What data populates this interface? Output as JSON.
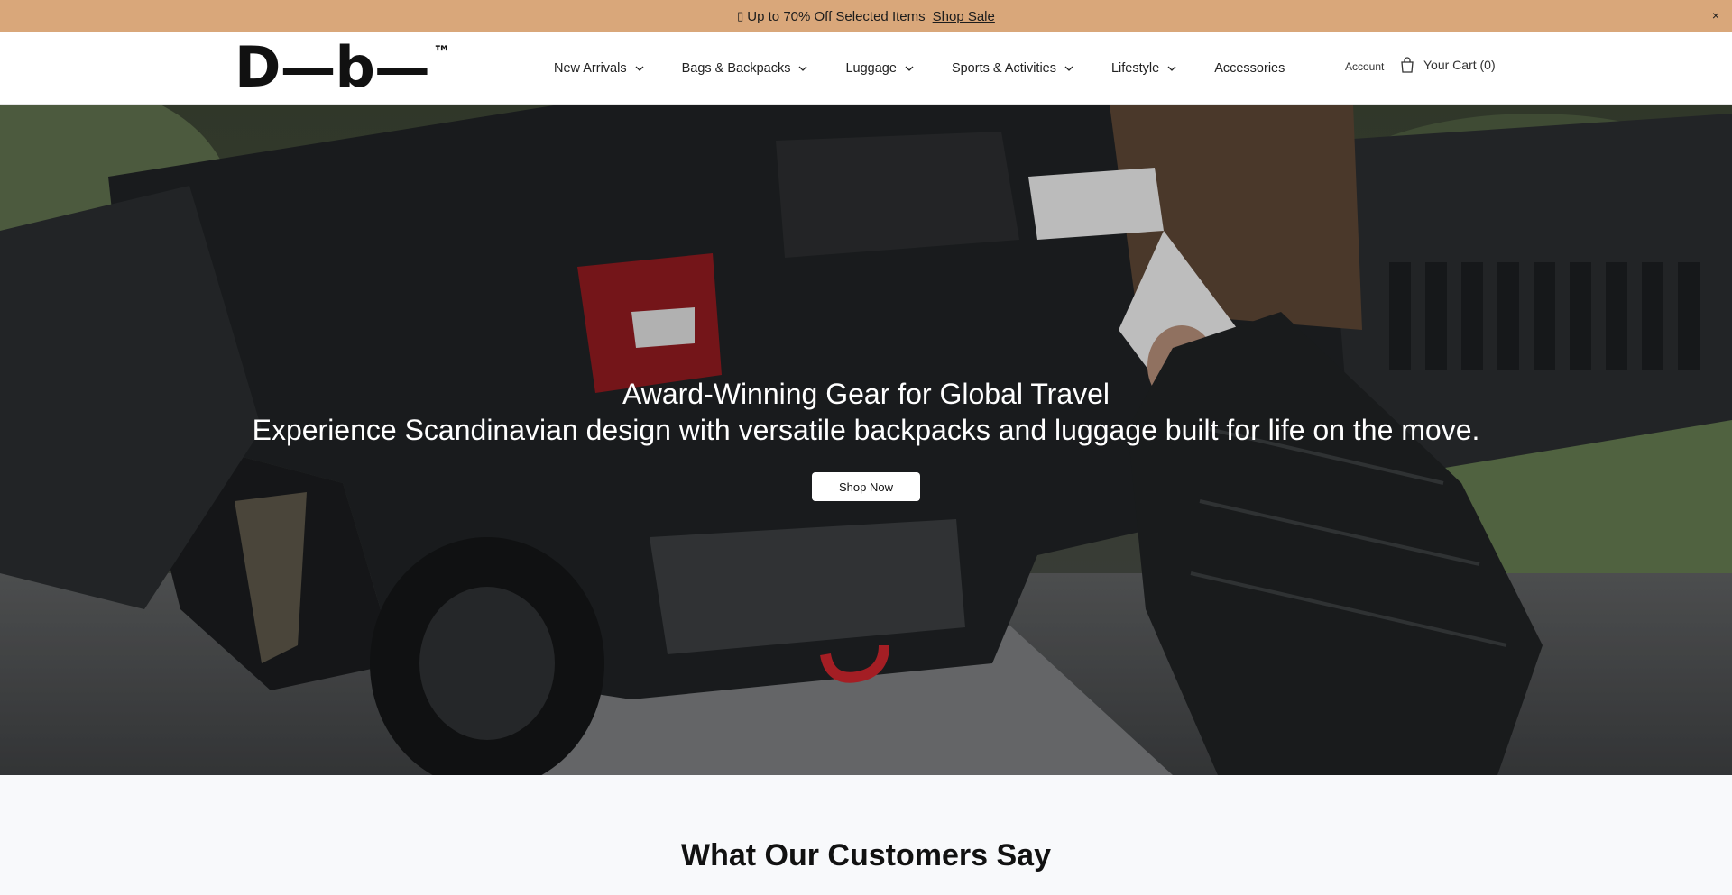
{
  "announcement": {
    "icon": "gift-icon",
    "message": "Up to 70% Off Selected Items",
    "link": "Shop Sale",
    "close": "×",
    "background": "#d9a77a"
  },
  "header": {
    "logo": "D—b—",
    "logo_tm": "™",
    "nav": [
      {
        "label": "New Arrivals",
        "has_dropdown": true
      },
      {
        "label": "Bags & Backpacks",
        "has_dropdown": true
      },
      {
        "label": "Luggage",
        "has_dropdown": true
      },
      {
        "label": "Sports & Activities",
        "has_dropdown": true
      },
      {
        "label": "Lifestyle",
        "has_dropdown": true
      },
      {
        "label": "Accessories",
        "has_dropdown": false
      }
    ],
    "account": "Account",
    "cart": "Your Cart (0)"
  },
  "hero": {
    "title": "Award-Winning Gear for Global Travel",
    "subtitle": "Experience Scandinavian design with versatile backpacks and luggage built for life on the move.",
    "button": "Shop Now"
  },
  "testimonials": {
    "heading": "What Our Customers Say"
  }
}
